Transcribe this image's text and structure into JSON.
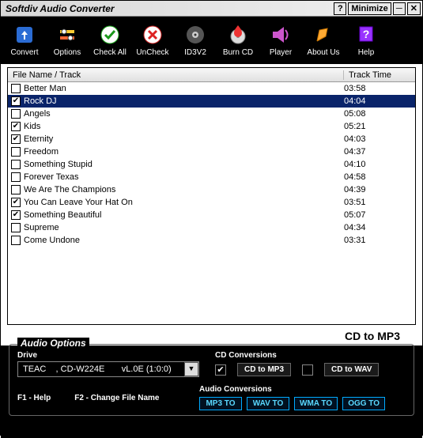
{
  "title": "Softdiv Audio Converter",
  "titlebar": {
    "help": "?",
    "minimize": "Minimize",
    "dash": "─",
    "close": "✕"
  },
  "toolbar": [
    {
      "name": "convert",
      "label": "Convert"
    },
    {
      "name": "options",
      "label": "Options"
    },
    {
      "name": "checkall",
      "label": "Check All"
    },
    {
      "name": "uncheck",
      "label": "UnCheck"
    },
    {
      "name": "id3v2",
      "label": "ID3V2"
    },
    {
      "name": "burncd",
      "label": "Burn CD"
    },
    {
      "name": "player",
      "label": "Player"
    },
    {
      "name": "aboutus",
      "label": "About Us"
    },
    {
      "name": "help",
      "label": "Help"
    }
  ],
  "columns": {
    "name": "File Name / Track",
    "time": "Track Time"
  },
  "tracks": [
    {
      "checked": false,
      "selected": false,
      "name": "Better Man",
      "time": "03:58"
    },
    {
      "checked": true,
      "selected": true,
      "name": "Rock DJ",
      "time": "04:04"
    },
    {
      "checked": false,
      "selected": false,
      "name": "Angels",
      "time": "05:08"
    },
    {
      "checked": true,
      "selected": false,
      "name": "Kids",
      "time": "05:21"
    },
    {
      "checked": true,
      "selected": false,
      "name": "Eternity",
      "time": "04:03"
    },
    {
      "checked": false,
      "selected": false,
      "name": "Freedom",
      "time": "04:37"
    },
    {
      "checked": false,
      "selected": false,
      "name": "Something Stupid",
      "time": "04:10"
    },
    {
      "checked": false,
      "selected": false,
      "name": "Forever Texas",
      "time": "04:58"
    },
    {
      "checked": false,
      "selected": false,
      "name": "We Are The Champions",
      "time": "04:39"
    },
    {
      "checked": true,
      "selected": false,
      "name": "You Can Leave Your Hat On",
      "time": "03:51"
    },
    {
      "checked": true,
      "selected": false,
      "name": "Something Beautiful",
      "time": "05:07"
    },
    {
      "checked": false,
      "selected": false,
      "name": "Supreme",
      "time": "04:34"
    },
    {
      "checked": false,
      "selected": false,
      "name": "Come Undone",
      "time": "03:31"
    }
  ],
  "mode": "CD to MP3",
  "options": {
    "title": "Audio Options",
    "drive_label": "Drive",
    "drive_value": "TEAC    , CD-W224E       vL.0E (1:0:0)",
    "cd_conv_label": "CD Conversions",
    "cd_to_mp3": {
      "checked": true,
      "label": "CD to MP3"
    },
    "cd_to_wav": {
      "checked": false,
      "label": "CD to WAV"
    },
    "audio_conv_label": "Audio Conversions",
    "audio_conv": [
      "MP3 TO",
      "WAV TO",
      "WMA TO",
      "OGG TO"
    ],
    "hint1": "F1 - Help",
    "hint2": "F2 - Change File Name"
  }
}
